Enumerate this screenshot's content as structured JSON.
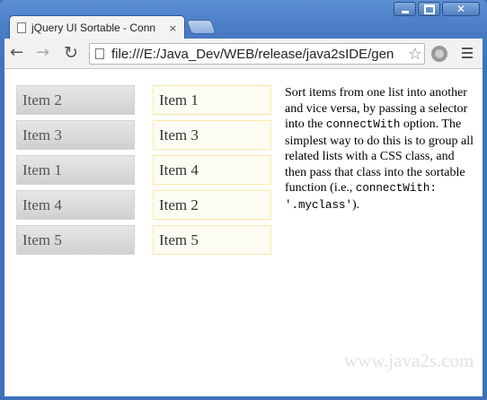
{
  "window": {
    "tab_title": "jQuery UI Sortable - Conn",
    "tab_close": "×"
  },
  "toolbar": {
    "url": "file:///E:/Java_Dev/WEB/release/java2sIDE/gen",
    "back": "←",
    "forward": "→",
    "reload": "↻",
    "star": "☆"
  },
  "lists": {
    "first": [
      "Item 2",
      "Item 3",
      "Item 1",
      "Item 4",
      "Item 5"
    ],
    "second": [
      "Item 1",
      "Item 3",
      "Item 4",
      "Item 2",
      "Item 5"
    ]
  },
  "description": {
    "part1": "Sort items from one list into another and vice versa, by passing a selector into the ",
    "code1": "connectWith",
    "part2": " option. The simplest way to do this is to group all related lists with a CSS class, and then pass that class into the sortable function (i.e., ",
    "code2": "connectWith: '.myclass'",
    "part3": ")."
  },
  "watermark": "www.java2s.com",
  "colors": {
    "frame": "#4a7dc6",
    "gray_item": "#dadada",
    "yellow_item_border": "#fbe9a8",
    "yellow_item_bg": "#fdfcf3"
  },
  "icons": {
    "page": "page-icon",
    "extension": "extension-icon",
    "menu": "menu-icon"
  }
}
